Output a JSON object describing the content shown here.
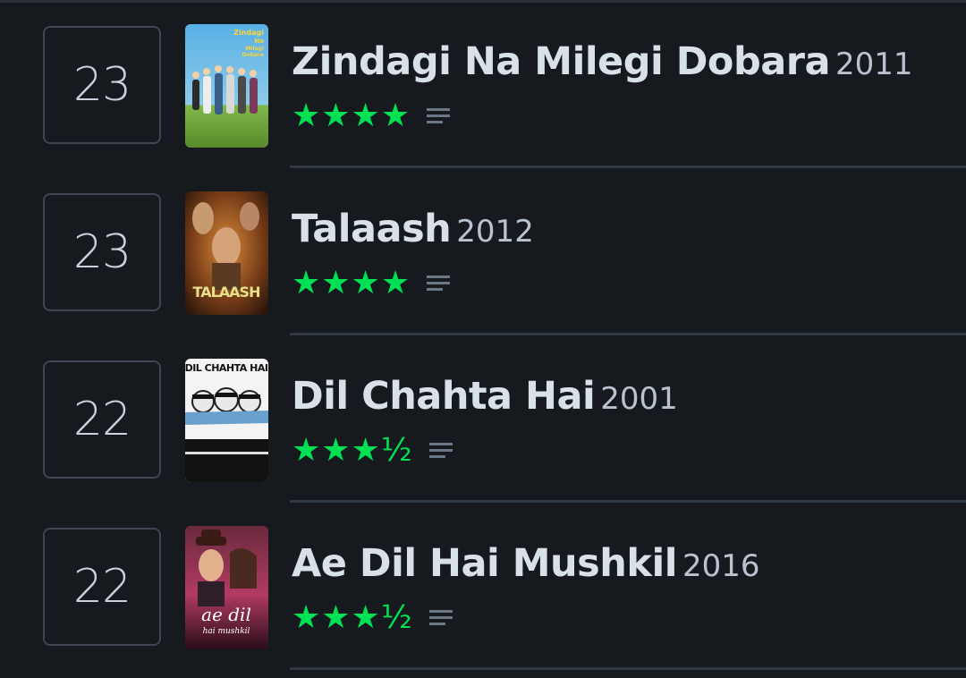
{
  "films": [
    {
      "rank": "23",
      "title": "Zindagi Na Milegi Dobara",
      "year": "2011",
      "stars": "★★★★",
      "rating_value": 4.0,
      "poster_label": "Zindagi Na Milegi Dobara",
      "poster_colors": [
        "#4aa0d8",
        "#a7d16a",
        "#e8c84a"
      ]
    },
    {
      "rank": "23",
      "title": "Talaash",
      "year": "2012",
      "stars": "★★★★",
      "rating_value": 4.0,
      "poster_label": "TALAASH",
      "poster_colors": [
        "#3a2414",
        "#b86a2a",
        "#e8c35a"
      ]
    },
    {
      "rank": "22",
      "title": "Dil Chahta Hai",
      "year": "2001",
      "stars": "★★★½",
      "rating_value": 3.5,
      "poster_label": "DIL CHAHTA HAI",
      "poster_colors": [
        "#f5f5f5",
        "#1b1b1b",
        "#6aa0cc"
      ]
    },
    {
      "rank": "22",
      "title": "Ae Dil Hai Mushkil",
      "year": "2016",
      "stars": "★★★½",
      "rating_value": 3.5,
      "poster_label": "ae dil hai mushkil",
      "poster_colors": [
        "#5a1f34",
        "#c83a6a",
        "#f0b6c8"
      ]
    }
  ],
  "colors": {
    "background": "#16191d",
    "star_green": "#00e054",
    "divider": "#2f3943",
    "rank_border": "#3d4652"
  },
  "icons": {
    "review": "review-lines-icon",
    "star": "star-icon"
  }
}
